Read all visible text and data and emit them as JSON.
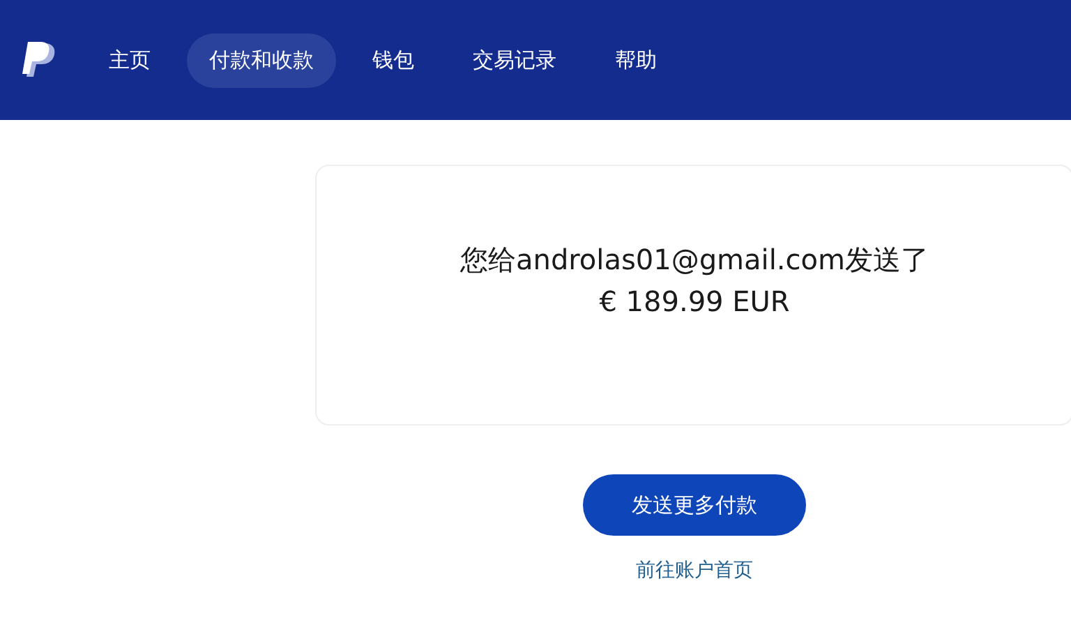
{
  "nav": {
    "items": [
      {
        "label": "主页",
        "selected": false
      },
      {
        "label": "付款和收款",
        "selected": true
      },
      {
        "label": "钱包",
        "selected": false
      },
      {
        "label": "交易记录",
        "selected": false
      },
      {
        "label": "帮助",
        "selected": false
      }
    ]
  },
  "confirmation": {
    "message": "您给androlas01@gmail.com发送了",
    "amount": "€ 189.99 EUR"
  },
  "primary_button": "发送更多付款",
  "link": "前往账户首页"
}
